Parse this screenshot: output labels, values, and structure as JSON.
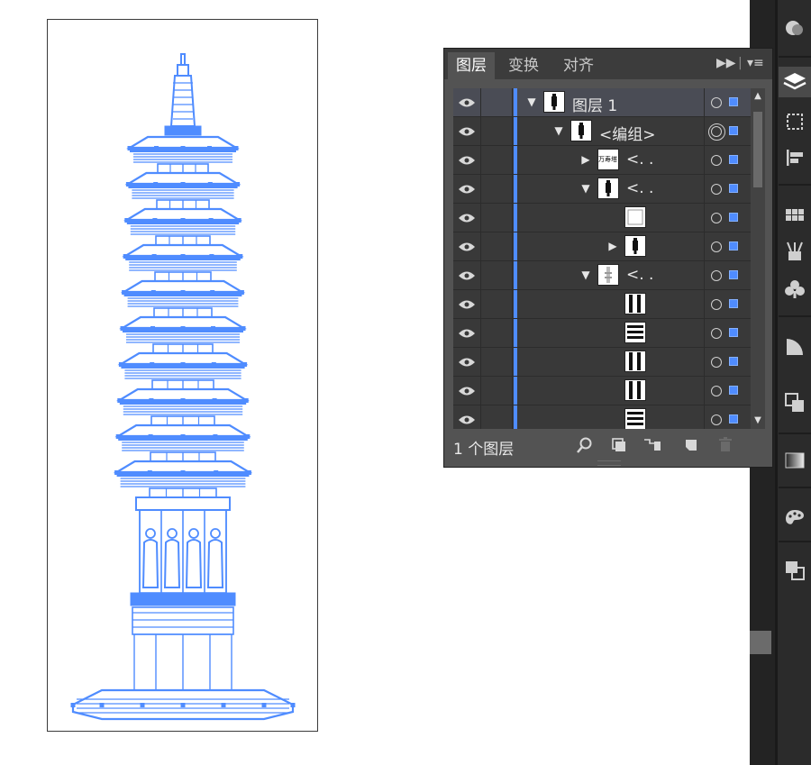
{
  "panel": {
    "tabs": [
      {
        "label": "图层",
        "active": true
      },
      {
        "label": "变换",
        "active": false
      },
      {
        "label": "对齐",
        "active": false
      }
    ],
    "menu_icon": "double-arrow-menu-icon",
    "footer": {
      "layer_count": "1 个图层"
    },
    "accent_color": "#4f8cff"
  },
  "layers": [
    {
      "depth": 0,
      "twisty": "open",
      "thumb": "pagoda",
      "label": "图层 1",
      "selected": true,
      "target": "single"
    },
    {
      "depth": 1,
      "twisty": "open",
      "thumb": "pagoda",
      "label": "<编组>",
      "selected": false,
      "target": "double"
    },
    {
      "depth": 2,
      "twisty": "closed",
      "thumb": "text",
      "label": "<. .",
      "selected": false,
      "target": "single"
    },
    {
      "depth": 2,
      "twisty": "open",
      "thumb": "pagoda",
      "label": "<. .",
      "selected": false,
      "target": "single"
    },
    {
      "depth": 3,
      "twisty": "none",
      "thumb": "square",
      "label": "",
      "selected": false,
      "target": "single"
    },
    {
      "depth": 3,
      "twisty": "closed",
      "thumb": "pagoda",
      "label": "",
      "selected": false,
      "target": "single"
    },
    {
      "depth": 2,
      "twisty": "open",
      "thumb": "faint",
      "label": "<. .",
      "selected": false,
      "target": "single"
    },
    {
      "depth": 3,
      "twisty": "none",
      "thumb": "pillars",
      "label": "",
      "selected": false,
      "target": "single"
    },
    {
      "depth": 3,
      "twisty": "none",
      "thumb": "bands",
      "label": "",
      "selected": false,
      "target": "single"
    },
    {
      "depth": 3,
      "twisty": "none",
      "thumb": "pillars",
      "label": "",
      "selected": false,
      "target": "single"
    },
    {
      "depth": 3,
      "twisty": "none",
      "thumb": "pillars",
      "label": "",
      "selected": false,
      "target": "single"
    },
    {
      "depth": 3,
      "twisty": "none",
      "thumb": "bands",
      "label": "",
      "selected": false,
      "target": "single"
    }
  ],
  "thumb_text": "万寿塔",
  "artwork": {
    "stroke_color": "#4f8cff",
    "tiers": 10
  }
}
